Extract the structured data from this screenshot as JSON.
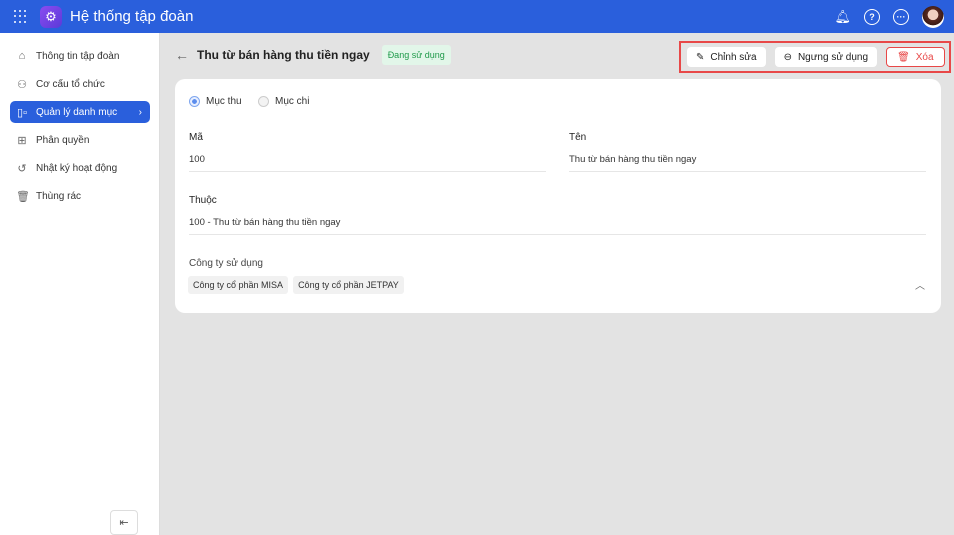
{
  "header": {
    "title": "Hệ thống tập đoàn",
    "icons": [
      "apps-grid-icon",
      "gear-icon",
      "bell-icon",
      "help-icon",
      "more-icon",
      "avatar"
    ]
  },
  "sidebar": {
    "items": [
      {
        "label": "Thông tin tập đoàn",
        "icon": "home-icon"
      },
      {
        "label": "Cơ cấu tổ chức",
        "icon": "org-chart-icon"
      },
      {
        "label": "Quản lý danh mục",
        "icon": "category-icon",
        "active": true
      },
      {
        "label": "Phân quyền",
        "icon": "permission-icon"
      },
      {
        "label": "Nhật ký hoạt động",
        "icon": "history-icon"
      },
      {
        "label": "Thùng rác",
        "icon": "trash-icon"
      }
    ]
  },
  "page": {
    "title": "Thu từ bán hàng thu tiền ngay",
    "status": "Đang sử dụng"
  },
  "actions": {
    "edit": "Chỉnh sửa",
    "deactivate": "Ngưng sử dụng",
    "delete": "Xóa"
  },
  "form": {
    "type_options": [
      "Mục thu",
      "Mục chi"
    ],
    "type_selected": "Mục thu",
    "code_label": "Mã",
    "code_value": "100",
    "name_label": "Tên",
    "name_value": "Thu từ bán hàng thu tiền ngay",
    "parent_label": "Thuộc",
    "parent_value": "100 - Thu từ bán hàng thu tiền ngay",
    "companies_label": "Công ty sử dụng",
    "companies": [
      "Công ty cổ phần MISA",
      "Công ty cổ phần JETPAY"
    ]
  },
  "colors": {
    "primary": "#2a5fdc",
    "danger": "#e84848",
    "success": "#1f9a4a"
  }
}
